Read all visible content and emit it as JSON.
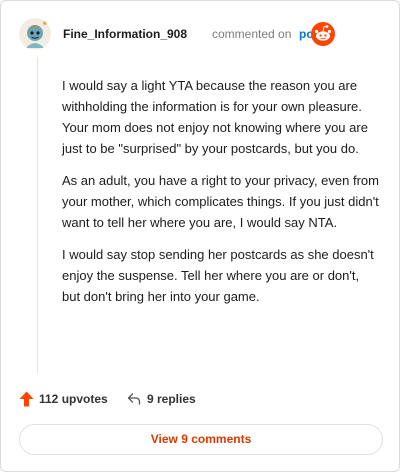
{
  "header": {
    "username": "Fine_Information_908",
    "action": "commented on",
    "post_link": "post",
    "brand": "reddit"
  },
  "comment": {
    "paragraphs": [
      "I would say a light YTA because the reason you are withholding the information is for your own pleasure. Your mom does not enjoy not knowing where you are just to be \"surprised\" by your postcards, but you do.",
      "As an adult, you have a right to your privacy, even from your mother, which complicates things. If you just didn't want to tell her where you are, I would say NTA.",
      "I would say stop sending her postcards as she doesn't enjoy the suspense. Tell her where you are or don't, but don't bring her into your game."
    ]
  },
  "footer": {
    "upvotes": "112 upvotes",
    "replies": "9 replies",
    "view_comments": "View 9 comments"
  },
  "colors": {
    "accent": "#ff4500",
    "link": "#0079d3",
    "button_text": "#d93a00"
  }
}
